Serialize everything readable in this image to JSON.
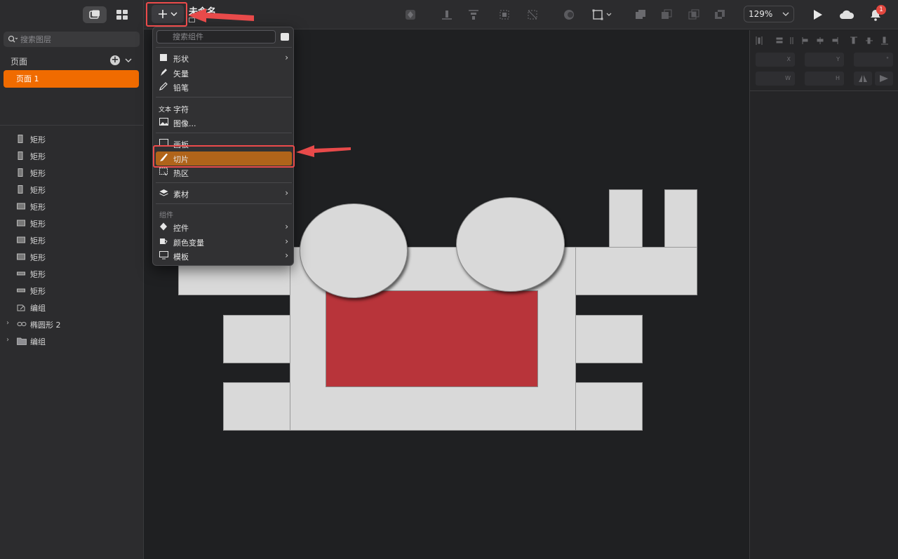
{
  "sidebar": {
    "search_placeholder": "搜索图层",
    "pages_title": "页面",
    "pages": [
      {
        "label": "页面 1"
      }
    ],
    "layers": [
      {
        "label": "矩形",
        "icon": "rect-vertical-icon"
      },
      {
        "label": "矩形",
        "icon": "rect-vertical-icon"
      },
      {
        "label": "矩形",
        "icon": "rect-vertical-icon"
      },
      {
        "label": "矩形",
        "icon": "rect-vertical-icon"
      },
      {
        "label": "矩形",
        "icon": "rect-icon"
      },
      {
        "label": "矩形",
        "icon": "rect-icon"
      },
      {
        "label": "矩形",
        "icon": "rect-icon"
      },
      {
        "label": "矩形",
        "icon": "rect-icon"
      },
      {
        "label": "矩形",
        "icon": "rect-thin-icon"
      },
      {
        "label": "矩形",
        "icon": "rect-thin-icon"
      },
      {
        "label": "编组",
        "icon": "group-icon"
      },
      {
        "label": "椭圆形 2",
        "icon": "ellipse-group-icon"
      },
      {
        "label": "编组",
        "icon": "folder-icon"
      }
    ]
  },
  "toolbar": {
    "doc_title": "未命名",
    "zoom": "129%",
    "notification_count": "1"
  },
  "menu": {
    "search_placeholder": "搜索组件",
    "items": {
      "shape": "形状",
      "vector": "矢量",
      "pencil": "铅笔",
      "text": "字符",
      "image": "图像...",
      "artboard": "画板",
      "slice": "切片",
      "hotspot": "热区",
      "assets": "素材",
      "components_section": "组件",
      "controls": "控件",
      "color_variables": "颜色变量",
      "templates": "模板"
    },
    "text_icon_label": "文本"
  },
  "inspector": {
    "x_label": "X",
    "y_label": "Y",
    "w_label": "W",
    "h_label": "H",
    "rotation_unit": "°"
  },
  "colors": {
    "accent_orange": "#f06b00",
    "selected_item": "#b0641a",
    "highlight_red": "#ec4b4b",
    "canvas_red": "#b8343a",
    "shape_gray": "#d9d9d9"
  }
}
